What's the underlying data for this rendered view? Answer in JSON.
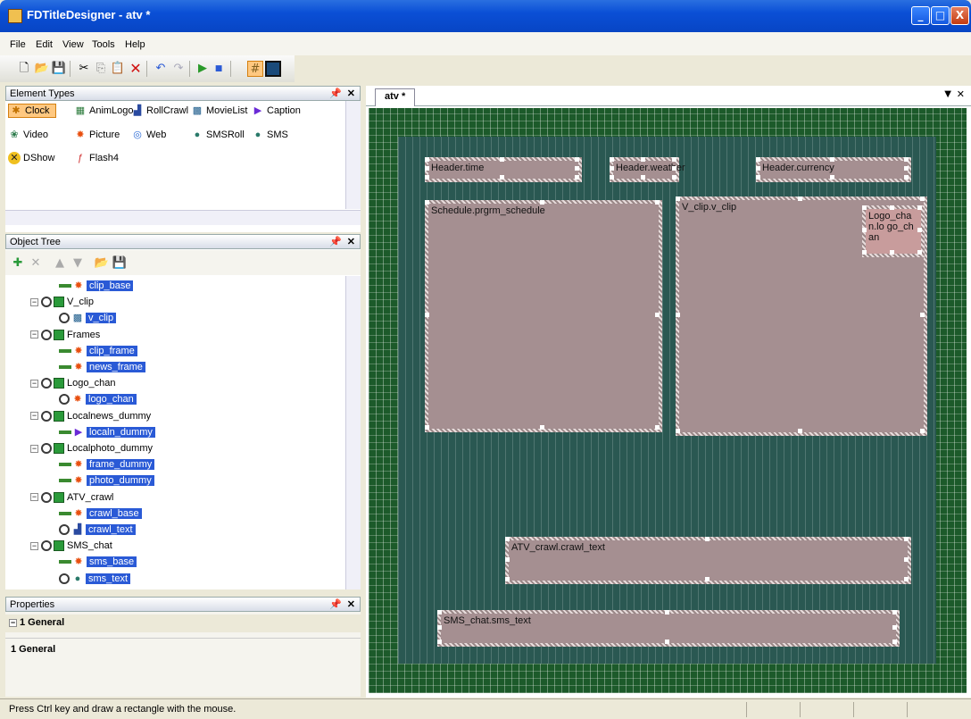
{
  "window": {
    "title": "FDTitleDesigner - atv *",
    "minimize": "_",
    "maximize": "□",
    "close": "X"
  },
  "menu": [
    "File",
    "Edit",
    "View",
    "Tools",
    "Help"
  ],
  "toolbar": {
    "icons": [
      "new-icon",
      "open-icon",
      "save-icon",
      "cut-icon",
      "copy-icon",
      "paste-icon",
      "delete-icon",
      "undo-icon",
      "redo-icon",
      "play-icon",
      "stop-icon",
      "grid-icon",
      "safe-area-icon"
    ]
  },
  "element_types": {
    "title": "Element Types",
    "items": [
      "Clock",
      "AnimLogo",
      "RollCrawl",
      "MovieList",
      "Caption",
      "Video",
      "Picture",
      "Web",
      "SMSRoll",
      "SMS",
      "DShow",
      "Flash4"
    ]
  },
  "object_tree": {
    "title": "Object Tree",
    "nodes": [
      {
        "label": "clip_base",
        "kind": "leaf"
      },
      {
        "label": "V_clip",
        "kind": "group"
      },
      {
        "label": "v_clip",
        "kind": "leaf"
      },
      {
        "label": "Frames",
        "kind": "group"
      },
      {
        "label": "clip_frame",
        "kind": "leaf"
      },
      {
        "label": "news_frame",
        "kind": "leaf"
      },
      {
        "label": "Logo_chan",
        "kind": "group"
      },
      {
        "label": "logo_chan",
        "kind": "leaf"
      },
      {
        "label": "Localnews_dummy",
        "kind": "group"
      },
      {
        "label": "localn_dummy",
        "kind": "leaf"
      },
      {
        "label": "Localphoto_dummy",
        "kind": "group"
      },
      {
        "label": "frame_dummy",
        "kind": "leaf"
      },
      {
        "label": "photo_dummy",
        "kind": "leaf"
      },
      {
        "label": "ATV_crawl",
        "kind": "group"
      },
      {
        "label": "crawl_base",
        "kind": "leaf"
      },
      {
        "label": "crawl_text",
        "kind": "leaf"
      },
      {
        "label": "SMS_chat",
        "kind": "group"
      },
      {
        "label": "sms_base",
        "kind": "leaf"
      },
      {
        "label": "sms_text",
        "kind": "leaf"
      }
    ]
  },
  "properties": {
    "title": "Properties",
    "category": "1 General",
    "selected": "1 General"
  },
  "document": {
    "tab": "atv *",
    "elements": [
      "Header.time",
      "Header.weather",
      "Header.currency",
      "Schedule.prgrm_schedule",
      "V_clip.v_clip",
      "Logo_chan.lo go_chan",
      "ATV_crawl.crawl_text",
      "SMS_chat.sms_text"
    ]
  },
  "status": "Press Ctrl key and draw a rectangle with the mouse."
}
